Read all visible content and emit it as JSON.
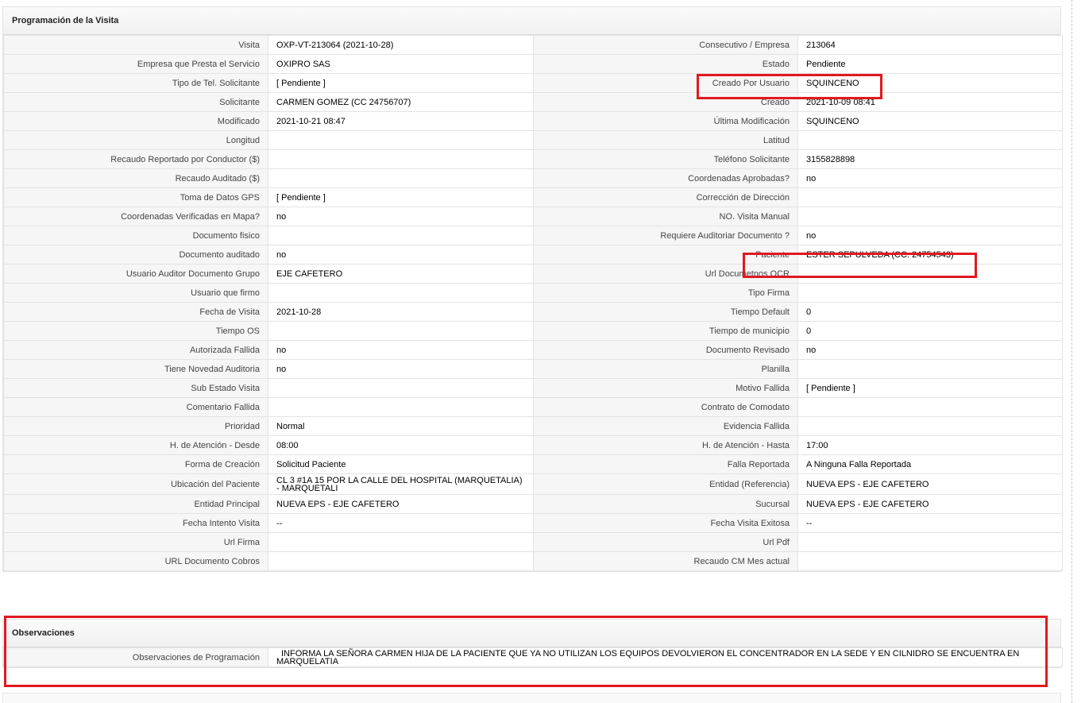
{
  "programacion": {
    "title": "Programación de la Visita",
    "rows": [
      {
        "l1": "Visita",
        "v1": "OXP-VT-213064 (2021-10-28)",
        "l2": "Consecutivo / Empresa",
        "v2": "213064"
      },
      {
        "l1": "Empresa que Presta el Servicio",
        "v1": "OXIPRO SAS",
        "l2": "Estado",
        "v2": "Pendiente"
      },
      {
        "l1": "Tipo de Tel. Solicitante",
        "v1": "[ Pendiente ]",
        "l2": "Creado Por Usuario",
        "v2": "SQUINCENO"
      },
      {
        "l1": "Solicitante",
        "v1": "CARMEN GOMEZ (CC 24756707)",
        "l2": "Creado",
        "v2": "2021-10-09 08:41"
      },
      {
        "l1": "Modificado",
        "v1": "2021-10-21 08:47",
        "l2": "Última Modificación",
        "v2": "SQUINCENO"
      },
      {
        "l1": "Longitud",
        "v1": "",
        "l2": "Latitud",
        "v2": ""
      },
      {
        "l1": "Recaudo Reportado por Conductor ($)",
        "v1": "",
        "l2": "Teléfono Solicitante",
        "v2": "3155828898"
      },
      {
        "l1": "Recaudo Auditado ($)",
        "v1": "",
        "l2": "Coordenadas Aprobadas?",
        "v2": "no"
      },
      {
        "l1": "Toma de Datos GPS",
        "v1": "[ Pendiente ]",
        "l2": "Corrección de Dirección",
        "v2": ""
      },
      {
        "l1": "Coordenadas Verificadas en Mapa?",
        "v1": "no",
        "l2": "NO. Visita Manual",
        "v2": ""
      },
      {
        "l1": "Documento fisico",
        "v1": "",
        "l2": "Requiere Auditoriar Documento ?",
        "v2": "no"
      },
      {
        "l1": "Documento auditado",
        "v1": "no",
        "l2": "Paciente",
        "v2": "ESTER SEPULVEDA (CC: 24754543)"
      },
      {
        "l1": "Usuario Auditor Documento Grupo",
        "v1": "EJE CAFETERO",
        "l2": "Url Documetnos OCR",
        "v2": ""
      },
      {
        "l1": "Usuario que firmo",
        "v1": "",
        "l2": "Tipo Firma",
        "v2": ""
      },
      {
        "l1": "Fecha de Visita",
        "v1": "2021-10-28",
        "l2": "Tiempo Default",
        "v2": "0"
      },
      {
        "l1": "Tiempo OS",
        "v1": "",
        "l2": "Tiempo de municipio",
        "v2": "0"
      },
      {
        "l1": "Autorizada Fallida",
        "v1": "no",
        "l2": "Documento Revisado",
        "v2": "no"
      },
      {
        "l1": "Tiene Novedad Auditoria",
        "v1": "no",
        "l2": "Planilla",
        "v2": ""
      },
      {
        "l1": "Sub Estado Visita",
        "v1": "",
        "l2": "Motivo Fallida",
        "v2": "[ Pendiente ]"
      },
      {
        "l1": "Comentario Fallida",
        "v1": "",
        "l2": "Contrato de Comodato",
        "v2": ""
      },
      {
        "l1": "Prioridad",
        "v1": "Normal",
        "l2": "Evidencia Fallida",
        "v2": ""
      },
      {
        "l1": "H. de Atención - Desde",
        "v1": "08:00",
        "l2": "H. de Atención - Hasta",
        "v2": "17:00"
      },
      {
        "l1": "Forma de Creación",
        "v1": "Solicitud Paciente",
        "l2": "Falla Reportada",
        "v2": "A Ninguna Falla Reportada"
      },
      {
        "l1": "Ubicación del Paciente",
        "v1": "CL 3 #1A 15 POR LA CALLE DEL HOSPITAL (MARQUETALIA) - MARQUETALI",
        "l2": "Entidad (Referencia)",
        "v2": "NUEVA EPS - EJE CAFETERO"
      },
      {
        "l1": "Entidad Principal",
        "v1": "NUEVA EPS - EJE CAFETERO",
        "l2": "Sucursal",
        "v2": "NUEVA EPS - EJE CAFETERO"
      },
      {
        "l1": "Fecha Intento Visita",
        "v1": "--",
        "l2": "Fecha Visita Exitosa",
        "v2": "--"
      },
      {
        "l1": "Url Firma",
        "v1": "",
        "l2": "Url Pdf",
        "v2": ""
      },
      {
        "l1": "URL Documento Cobros",
        "v1": "",
        "l2": "Recaudo CM Mes actual",
        "v2": ""
      }
    ]
  },
  "observaciones": {
    "title": "Observaciones",
    "label": "Observaciones de Programación",
    "value": "INFORMA LA SEÑORA CARMEN HIJA DE LA PACIENTE QUE YA NO UTILIZAN LOS EQUIPOS DEVOLVIERON EL CONCENTRADOR EN LA SEDE Y EN CILNIDRO SE ENCUENTRA EN MARQUELATIA"
  },
  "colors": {
    "highlight": "#e0191f",
    "label_bg": "#f6f6f6",
    "border": "#e3e3e3"
  }
}
